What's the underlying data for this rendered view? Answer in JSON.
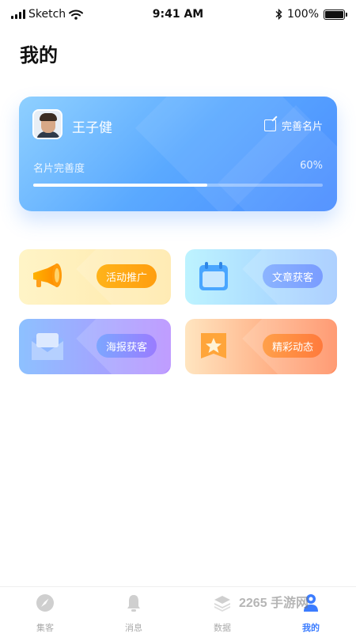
{
  "status_bar": {
    "carrier": "Sketch",
    "time": "9:41 AM",
    "battery": "100%"
  },
  "page": {
    "title": "我的"
  },
  "profile": {
    "name": "王子健",
    "edit_label": "完善名片",
    "progress_label": "名片完善度",
    "progress_text": "60%",
    "progress_value": 0.6
  },
  "features": [
    {
      "label": "活动推广",
      "icon": "megaphone-icon"
    },
    {
      "label": "文章获客",
      "icon": "calendar-icon"
    },
    {
      "label": "海报获客",
      "icon": "envelope-icon"
    },
    {
      "label": "精彩动态",
      "icon": "star-badge-icon"
    }
  ],
  "tabs": [
    {
      "label": "集客",
      "icon": "compass-icon",
      "active": false
    },
    {
      "label": "消息",
      "icon": "bell-icon",
      "active": false
    },
    {
      "label": "数据",
      "icon": "layers-icon",
      "active": false
    },
    {
      "label": "我的",
      "icon": "user-icon",
      "active": true
    }
  ],
  "watermark": "2265 手游网",
  "colors": {
    "accent": "#3b7cff",
    "card": "#5aa9ff"
  }
}
